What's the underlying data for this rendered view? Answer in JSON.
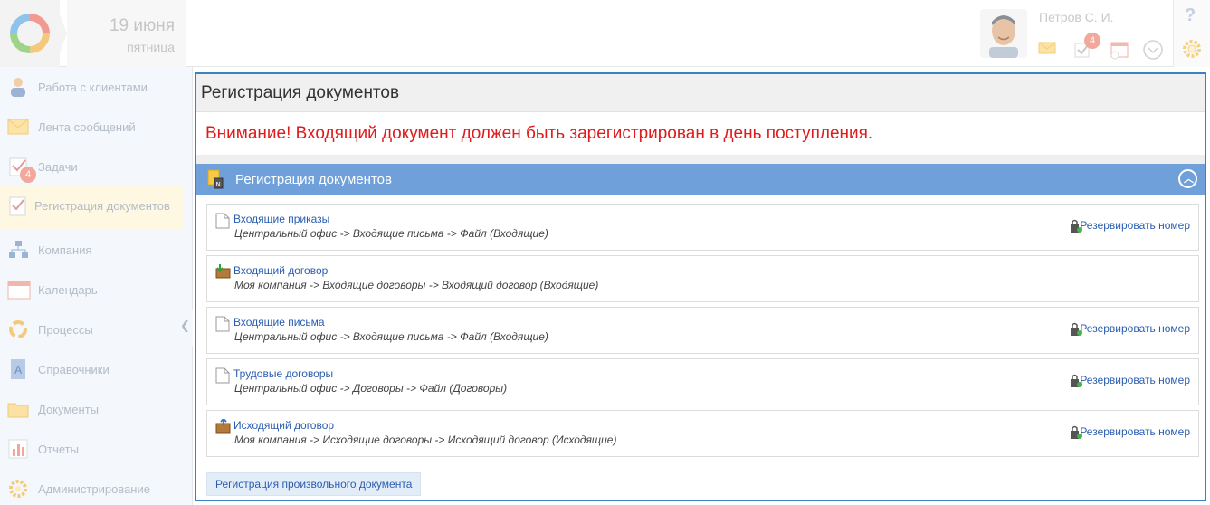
{
  "header": {
    "date_day": "19 июня",
    "date_weekday": "пятница",
    "user_name": "Петров С. И.",
    "tasks_badge": "4",
    "help_label": "?"
  },
  "sidebar": {
    "items": [
      {
        "label": "Работа с клиентами",
        "icon": "clients-icon"
      },
      {
        "label": "Лента сообщений",
        "icon": "messages-icon"
      },
      {
        "label": "Задачи",
        "icon": "tasks-icon",
        "badge": "4"
      },
      {
        "label": "Регистрация документов",
        "icon": "registration-icon",
        "active": true
      },
      {
        "label": "Компания",
        "icon": "company-icon"
      },
      {
        "label": "Календарь",
        "icon": "calendar-icon"
      },
      {
        "label": "Процессы",
        "icon": "processes-icon"
      },
      {
        "label": "Справочники",
        "icon": "directories-icon"
      },
      {
        "label": "Документы",
        "icon": "documents-icon"
      },
      {
        "label": "Отчеты",
        "icon": "reports-icon"
      },
      {
        "label": "Администрирование",
        "icon": "admin-icon"
      }
    ]
  },
  "main": {
    "title": "Регистрация документов",
    "warning": "Внимание! Входящий документ должен быть зарегистрирован в день поступления.",
    "section_title": "Регистрация документов",
    "reserve_label": "Резервировать номер",
    "documents": [
      {
        "name": "Входящие приказы",
        "path": "Центральный офис -> Входящие письма -> Файл (Входящие)",
        "icon": "file-icon",
        "reserve": true
      },
      {
        "name": "Входящий договор",
        "path": "Моя компания -> Входящие договоры -> Входящий договор (Входящие)",
        "icon": "incoming-contract-icon",
        "reserve": false
      },
      {
        "name": "Входящие письма",
        "path": "Центральный офис -> Входящие письма -> Файл (Входящие)",
        "icon": "file-icon",
        "reserve": true
      },
      {
        "name": "Трудовые договоры",
        "path": "Центральный офис -> Договоры -> Файл (Договоры)",
        "icon": "file-icon",
        "reserve": true
      },
      {
        "name": "Исходящий договор",
        "path": "Моя компания -> Исходящие договоры -> Исходящий договор (Исходящие)",
        "icon": "outgoing-contract-icon",
        "reserve": true
      }
    ],
    "free_doc_button": "Регистрация произвольного документа"
  },
  "colors": {
    "accent": "#3b82c4",
    "section_bar": "#6fa0da",
    "warning": "#e01b1b",
    "link": "#2a5db0",
    "active_nav": "#fef7e2"
  }
}
